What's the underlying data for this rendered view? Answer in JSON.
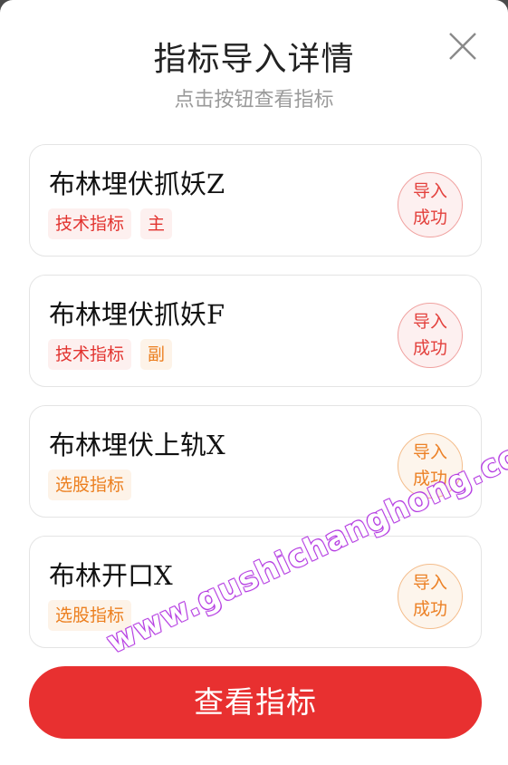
{
  "modal": {
    "title": "指标导入详情",
    "subtitle": "点击按钮查看指标",
    "close_icon": "close-icon"
  },
  "indicators": [
    {
      "name": "布林埋伏抓妖Z",
      "tags": [
        {
          "label": "技术指标",
          "color": "red"
        },
        {
          "label": "主",
          "color": "red"
        }
      ],
      "status_line1": "导入",
      "status_line2": "成功",
      "status_color": "red"
    },
    {
      "name": "布林埋伏抓妖F",
      "tags": [
        {
          "label": "技术指标",
          "color": "red"
        },
        {
          "label": "副",
          "color": "orange"
        }
      ],
      "status_line1": "导入",
      "status_line2": "成功",
      "status_color": "red"
    },
    {
      "name": "布林埋伏上轨X",
      "tags": [
        {
          "label": "选股指标",
          "color": "orange"
        }
      ],
      "status_line1": "导入",
      "status_line2": "成功",
      "status_color": "orange"
    },
    {
      "name": "布林开口X",
      "tags": [
        {
          "label": "选股指标",
          "color": "orange"
        }
      ],
      "status_line1": "导入",
      "status_line2": "成功",
      "status_color": "orange"
    }
  ],
  "footer": {
    "view_button_label": "查看指标"
  },
  "watermark": "www.gushichanghong.com",
  "colors": {
    "primary_red": "#e83030",
    "tag_red": "#e2332f",
    "tag_orange": "#ec7f1f",
    "watermark_purple": "#b030e0"
  }
}
